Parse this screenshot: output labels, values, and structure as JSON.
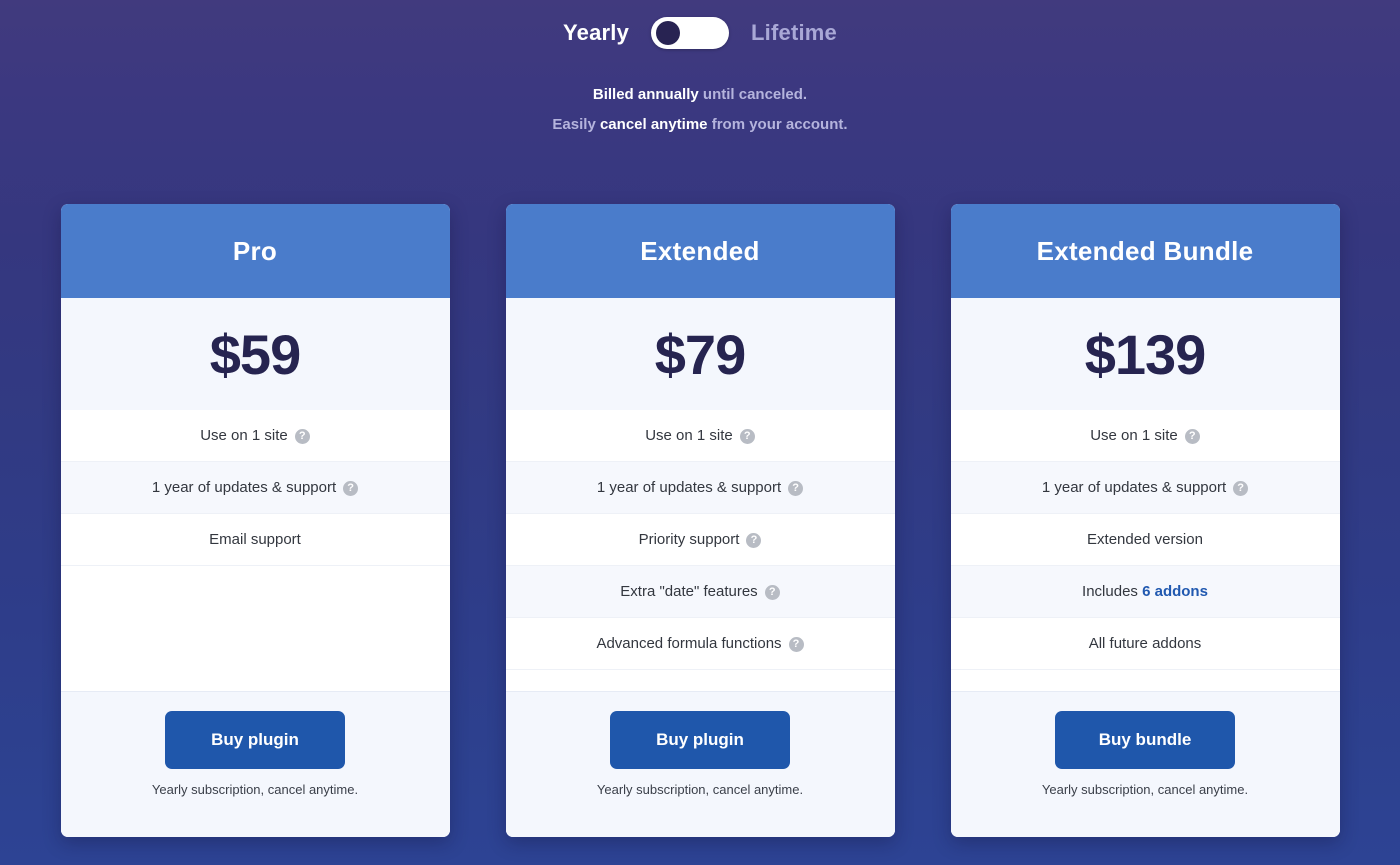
{
  "billing_toggle": {
    "left_label": "Yearly",
    "right_label": "Lifetime",
    "selected": "Yearly",
    "toggle_name": "billing-period-toggle"
  },
  "billing_note": {
    "line1_strong": "Billed annually",
    "line1_rest": " until canceled.",
    "line2_pre": "Easily ",
    "line2_strong": "cancel anytime",
    "line2_rest": " from your account."
  },
  "colors": {
    "card_header": "#4a7ccb",
    "buy_button": "#1f57ab",
    "price_text": "#262450",
    "highlight": "#2159b0",
    "background_top": "#413a7e",
    "background_bottom": "#2d4394"
  },
  "help_icon_glyph": "?",
  "plans": [
    {
      "name": "Pro",
      "price": "$59",
      "features": [
        {
          "text": "Use on 1 site",
          "help": true
        },
        {
          "text": "1 year of updates & support",
          "help": true
        },
        {
          "text": "Email support",
          "help": false
        }
      ],
      "button_label": "Buy plugin",
      "footer_note": "Yearly subscription, cancel anytime."
    },
    {
      "name": "Extended",
      "price": "$79",
      "features": [
        {
          "text": "Use on 1 site",
          "help": true
        },
        {
          "text": "1 year of updates & support",
          "help": true
        },
        {
          "text": "Priority support",
          "help": true
        },
        {
          "text": "Extra \"date\" features",
          "help": true
        },
        {
          "text": "Advanced formula functions",
          "help": true
        }
      ],
      "button_label": "Buy plugin",
      "footer_note": "Yearly subscription, cancel anytime."
    },
    {
      "name": "Extended Bundle",
      "price": "$139",
      "features": [
        {
          "text": "Use on 1 site",
          "help": true
        },
        {
          "text": "1 year of updates & support",
          "help": true
        },
        {
          "text": "Extended version",
          "help": false
        },
        {
          "text_pre": "Includes ",
          "highlight": "6 addons",
          "help": false
        },
        {
          "text": "All future addons",
          "help": false
        }
      ],
      "button_label": "Buy bundle",
      "footer_note": "Yearly subscription, cancel anytime."
    }
  ]
}
